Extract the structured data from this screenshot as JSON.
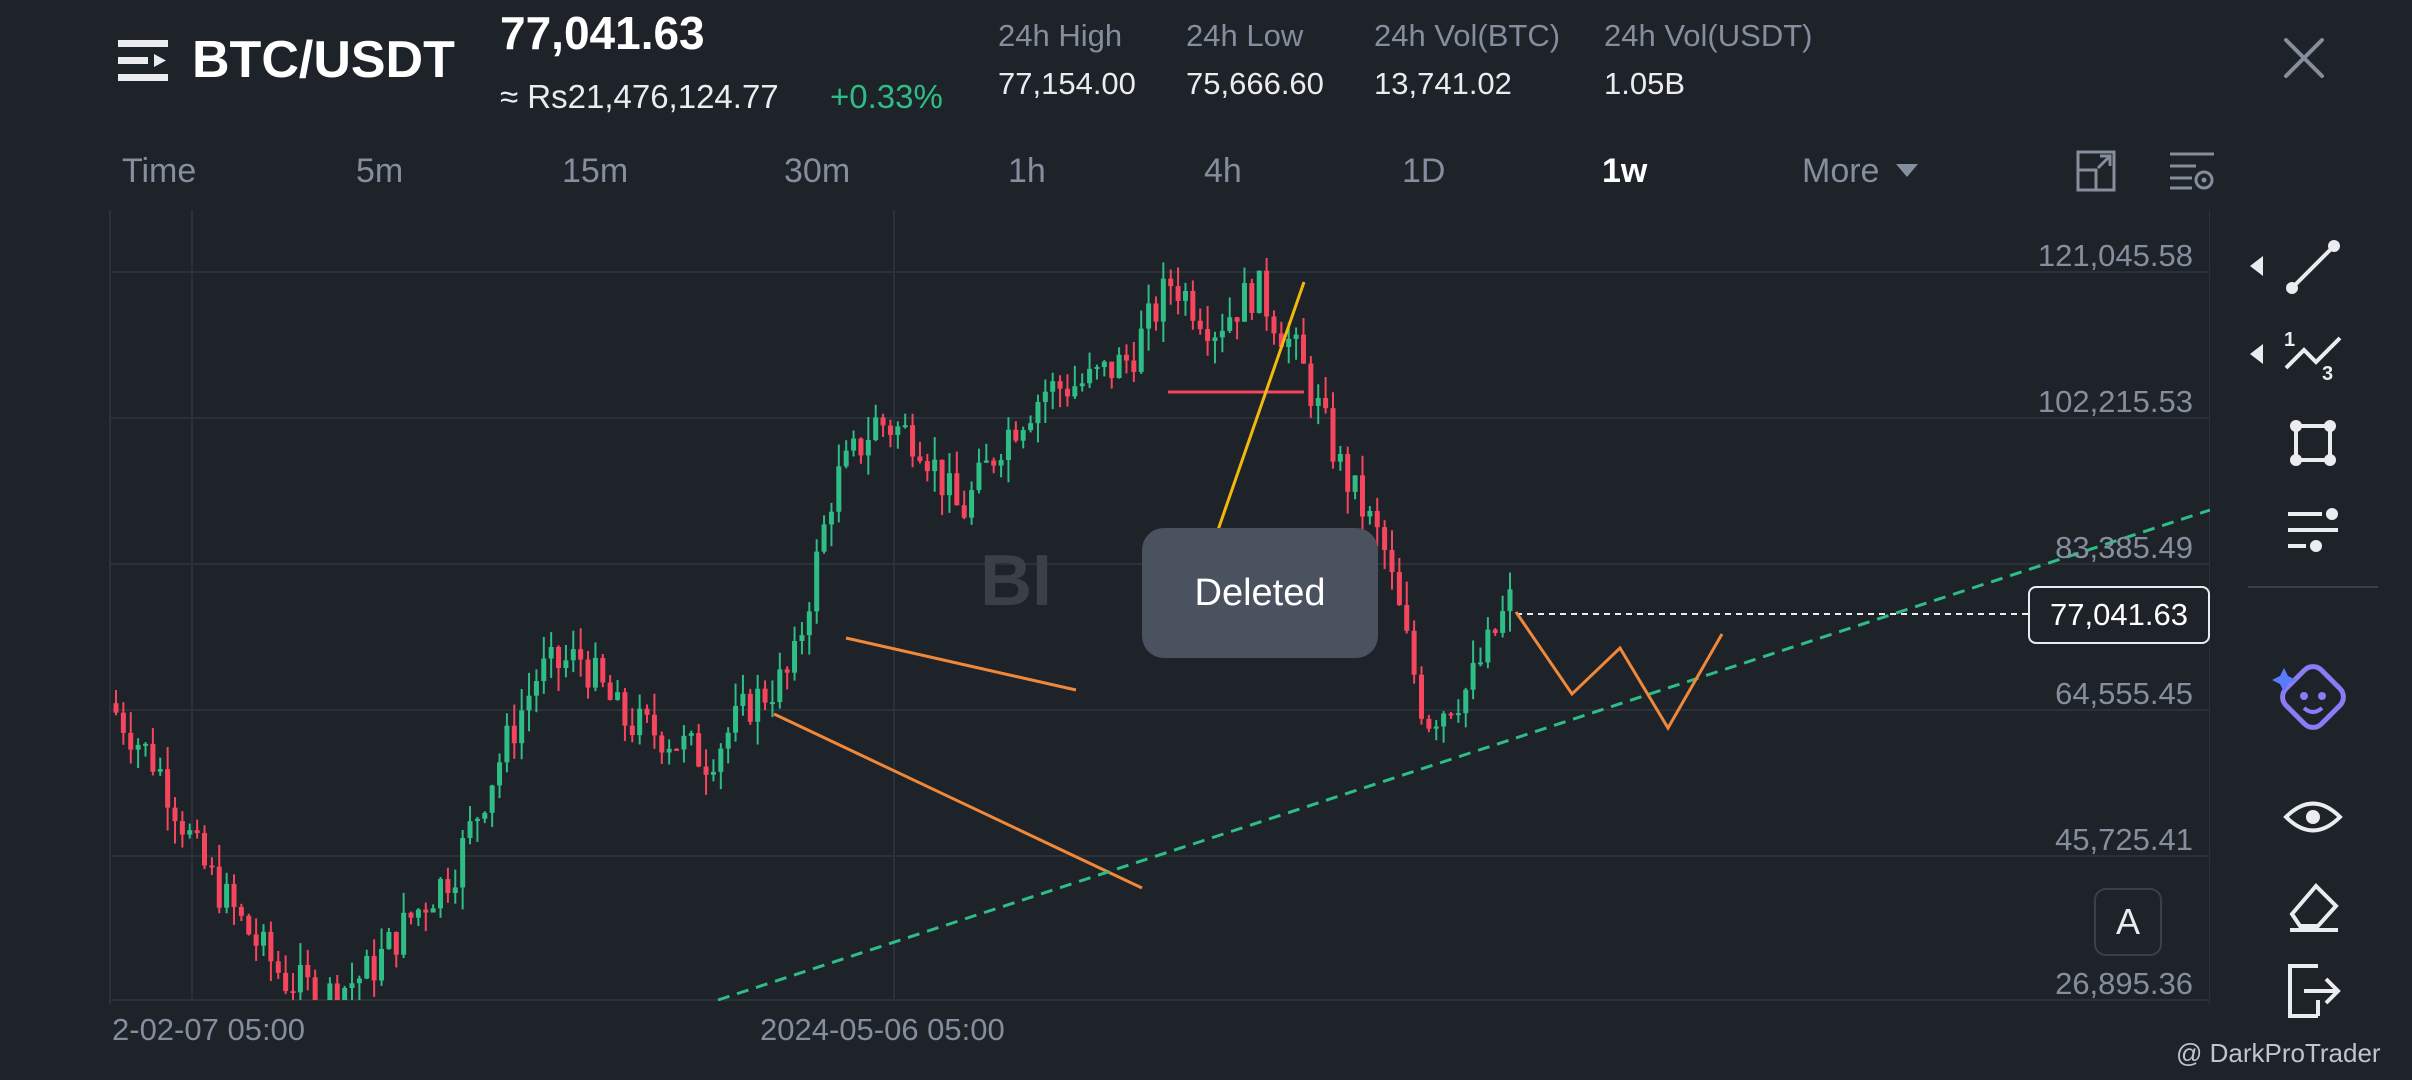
{
  "header": {
    "pair": "BTC/USDT",
    "last_price": "77,041.63",
    "fiat_price": "≈ Rs21,476,124.77",
    "change": "+0.33%",
    "stats": [
      {
        "label": "24h High",
        "value": "77,154.00"
      },
      {
        "label": "24h Low",
        "value": "75,666.60"
      },
      {
        "label": "24h Vol(BTC)",
        "value": "13,741.02"
      },
      {
        "label": "24h Vol(USDT)",
        "value": "1.05B"
      }
    ]
  },
  "timeframes": {
    "items": [
      "Time",
      "5m",
      "15m",
      "30m",
      "1h",
      "4h",
      "1D",
      "1w"
    ],
    "active": "1w",
    "more": "More"
  },
  "chart": {
    "price_labels": [
      "121,045.58",
      "102,215.53",
      "83,385.49",
      "64,555.45",
      "45,725.41",
      "26,895.36"
    ],
    "current_price": "77,041.63",
    "date_labels": [
      "2-02-07 05:00",
      "2024-05-06 05:00"
    ],
    "watermark": "BI",
    "auto_label": "A",
    "toast": "Deleted"
  },
  "credit": "@ DarkProTrader",
  "colors": {
    "background": "#1e2229",
    "up": "#2ebd85",
    "down": "#f6465d",
    "drawing_orange": "#f0883a",
    "drawing_yellow": "#f0b90b",
    "trendline_green": "#2ebd85"
  },
  "icons": {
    "menu": "list-menu-icon",
    "close": "close-icon",
    "toolbar": [
      "trend-line-icon",
      "fibonacci-icon",
      "rectangle-icon",
      "parallel-lines-icon",
      "magnet-ai-icon",
      "eye-icon",
      "eraser-icon",
      "exit-icon"
    ]
  },
  "chart_data": {
    "type": "candlestick",
    "x_axis": "weekly time",
    "y_axis_ticks": [
      121045.58,
      102215.53,
      83385.49,
      64555.45,
      45725.41,
      26895.36
    ],
    "current_price": 77041.63,
    "approx_closes": [
      63000,
      56000,
      44000,
      36000,
      29000,
      27000,
      30000,
      37000,
      43000,
      56000,
      68000,
      70000,
      62000,
      60000,
      57000,
      64000,
      68000,
      92000,
      100000,
      98000,
      88000,
      98000,
      104000,
      105000,
      108000,
      118000,
      112000,
      117000,
      108000,
      94000,
      84000,
      62000,
      66000,
      77041
    ]
  }
}
